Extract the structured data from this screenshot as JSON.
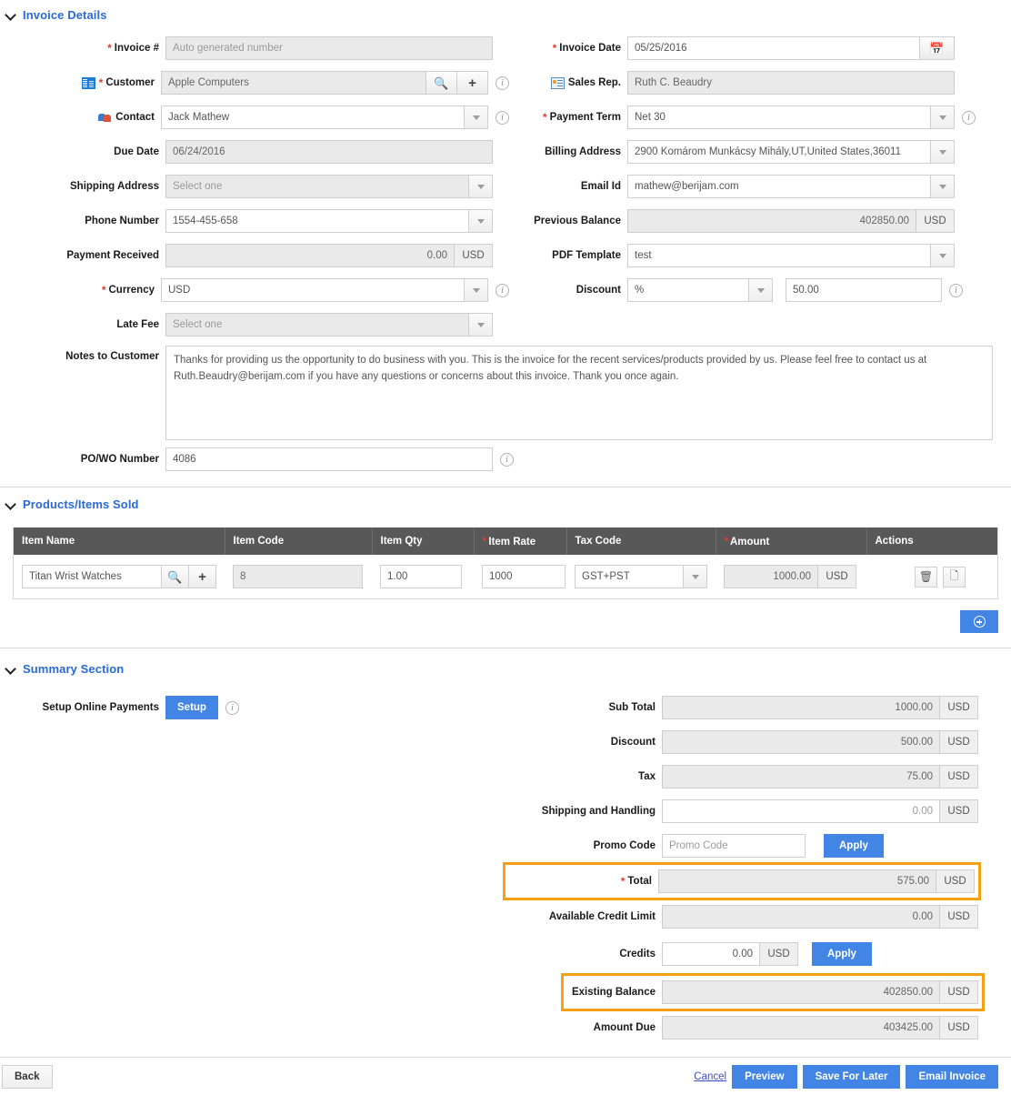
{
  "sections": {
    "invoice_details": "Invoice Details",
    "products": "Products/Items Sold",
    "summary": "Summary Section"
  },
  "left_fields": {
    "invoice_no": {
      "label": "Invoice #",
      "placeholder": "Auto generated number",
      "value": ""
    },
    "customer": {
      "label": "Customer",
      "value": "Apple Computers",
      "search_icon": "search-icon",
      "add_icon": "plus-icon"
    },
    "contact": {
      "label": "Contact",
      "value": "Jack Mathew"
    },
    "due_date": {
      "label": "Due Date",
      "value": "06/24/2016"
    },
    "shipping_address": {
      "label": "Shipping Address",
      "placeholder": "Select one",
      "value": ""
    },
    "phone_number": {
      "label": "Phone Number",
      "value": "1554-455-658"
    },
    "payment_received": {
      "label": "Payment Received",
      "value": "0.00",
      "currency": "USD"
    },
    "currency": {
      "label": "Currency",
      "value": "USD"
    },
    "late_fee": {
      "label": "Late Fee",
      "placeholder": "Select one",
      "value": ""
    },
    "notes": {
      "label": "Notes to Customer",
      "value": "Thanks for providing us the opportunity to do business with you. This is the invoice for the recent services/products provided by us. Please feel free to contact us at Ruth.Beaudry@berijam.com if you have any questions or concerns about this invoice. Thank you once again."
    },
    "po_wo": {
      "label": "PO/WO Number",
      "value": "4086"
    }
  },
  "right_fields": {
    "invoice_date": {
      "label": "Invoice Date",
      "value": "05/25/2016",
      "icon": "calendar-icon"
    },
    "sales_rep": {
      "label": "Sales Rep.",
      "value": "Ruth C. Beaudry"
    },
    "payment_term": {
      "label": "Payment Term",
      "value": "Net 30"
    },
    "billing_address": {
      "label": "Billing Address",
      "value": "2900 Komárom Munkácsy Mihály,UT,United States,36011"
    },
    "email_id": {
      "label": "Email Id",
      "value": "mathew@berijam.com"
    },
    "previous_balance": {
      "label": "Previous Balance",
      "value": "402850.00",
      "currency": "USD"
    },
    "pdf_template": {
      "label": "PDF Template",
      "value": "test"
    },
    "discount": {
      "label": "Discount",
      "type_value": "%",
      "value": "50.00"
    }
  },
  "items_table": {
    "columns": [
      {
        "label": "Item Name",
        "required": false
      },
      {
        "label": "Item Code",
        "required": false
      },
      {
        "label": "Item Qty",
        "required": false
      },
      {
        "label": "Item Rate",
        "required": true
      },
      {
        "label": "Tax Code",
        "required": false
      },
      {
        "label": "Amount",
        "required": true
      },
      {
        "label": "Actions",
        "required": false
      }
    ],
    "rows": [
      {
        "item_name": "Titan Wrist Watches",
        "item_code": "8",
        "item_qty": "1.00",
        "item_rate": "1000",
        "tax_code": "GST+PST",
        "amount": "1000.00",
        "currency": "USD"
      }
    ],
    "add_row_label": "add-item-row"
  },
  "summary": {
    "setup_online_payments_label": "Setup Online Payments",
    "setup_button": "Setup",
    "rows": [
      {
        "key": "sub_total",
        "label": "Sub Total",
        "value": "1000.00",
        "currency": "USD",
        "readonly": true,
        "required": false,
        "highlight": false
      },
      {
        "key": "discount",
        "label": "Discount",
        "value": "500.00",
        "currency": "USD",
        "readonly": true,
        "required": false,
        "highlight": false
      },
      {
        "key": "tax",
        "label": "Tax",
        "value": "75.00",
        "currency": "USD",
        "readonly": true,
        "required": false,
        "highlight": false
      },
      {
        "key": "shipping_handling",
        "label": "Shipping and Handling",
        "value": "0.00",
        "currency": "USD",
        "readonly": false,
        "required": false,
        "highlight": false
      },
      {
        "key": "total",
        "label": "Total",
        "value": "575.00",
        "currency": "USD",
        "readonly": true,
        "required": true,
        "highlight": true
      },
      {
        "key": "available_credit_limit",
        "label": "Available Credit Limit",
        "value": "0.00",
        "currency": "USD",
        "readonly": true,
        "required": false,
        "highlight": false
      },
      {
        "key": "existing_balance",
        "label": "Existing Balance",
        "value": "402850.00",
        "currency": "USD",
        "readonly": true,
        "required": false,
        "highlight": true
      },
      {
        "key": "amount_due",
        "label": "Amount Due",
        "value": "403425.00",
        "currency": "USD",
        "readonly": true,
        "required": false,
        "highlight": false
      }
    ],
    "promo": {
      "label": "Promo Code",
      "placeholder": "Promo Code",
      "value": "",
      "apply": "Apply"
    },
    "credits": {
      "label": "Credits",
      "value": "0.00",
      "currency": "USD",
      "apply": "Apply"
    }
  },
  "footer": {
    "back": "Back",
    "cancel": "Cancel",
    "preview": "Preview",
    "save_for_later": "Save For Later",
    "email_invoice": "Email Invoice"
  },
  "colors": {
    "accent_blue": "#4285e4",
    "section_title": "#2a6ad4",
    "required_red": "#e23b30",
    "highlight_orange": "#f4a013",
    "table_header": "#585858"
  }
}
